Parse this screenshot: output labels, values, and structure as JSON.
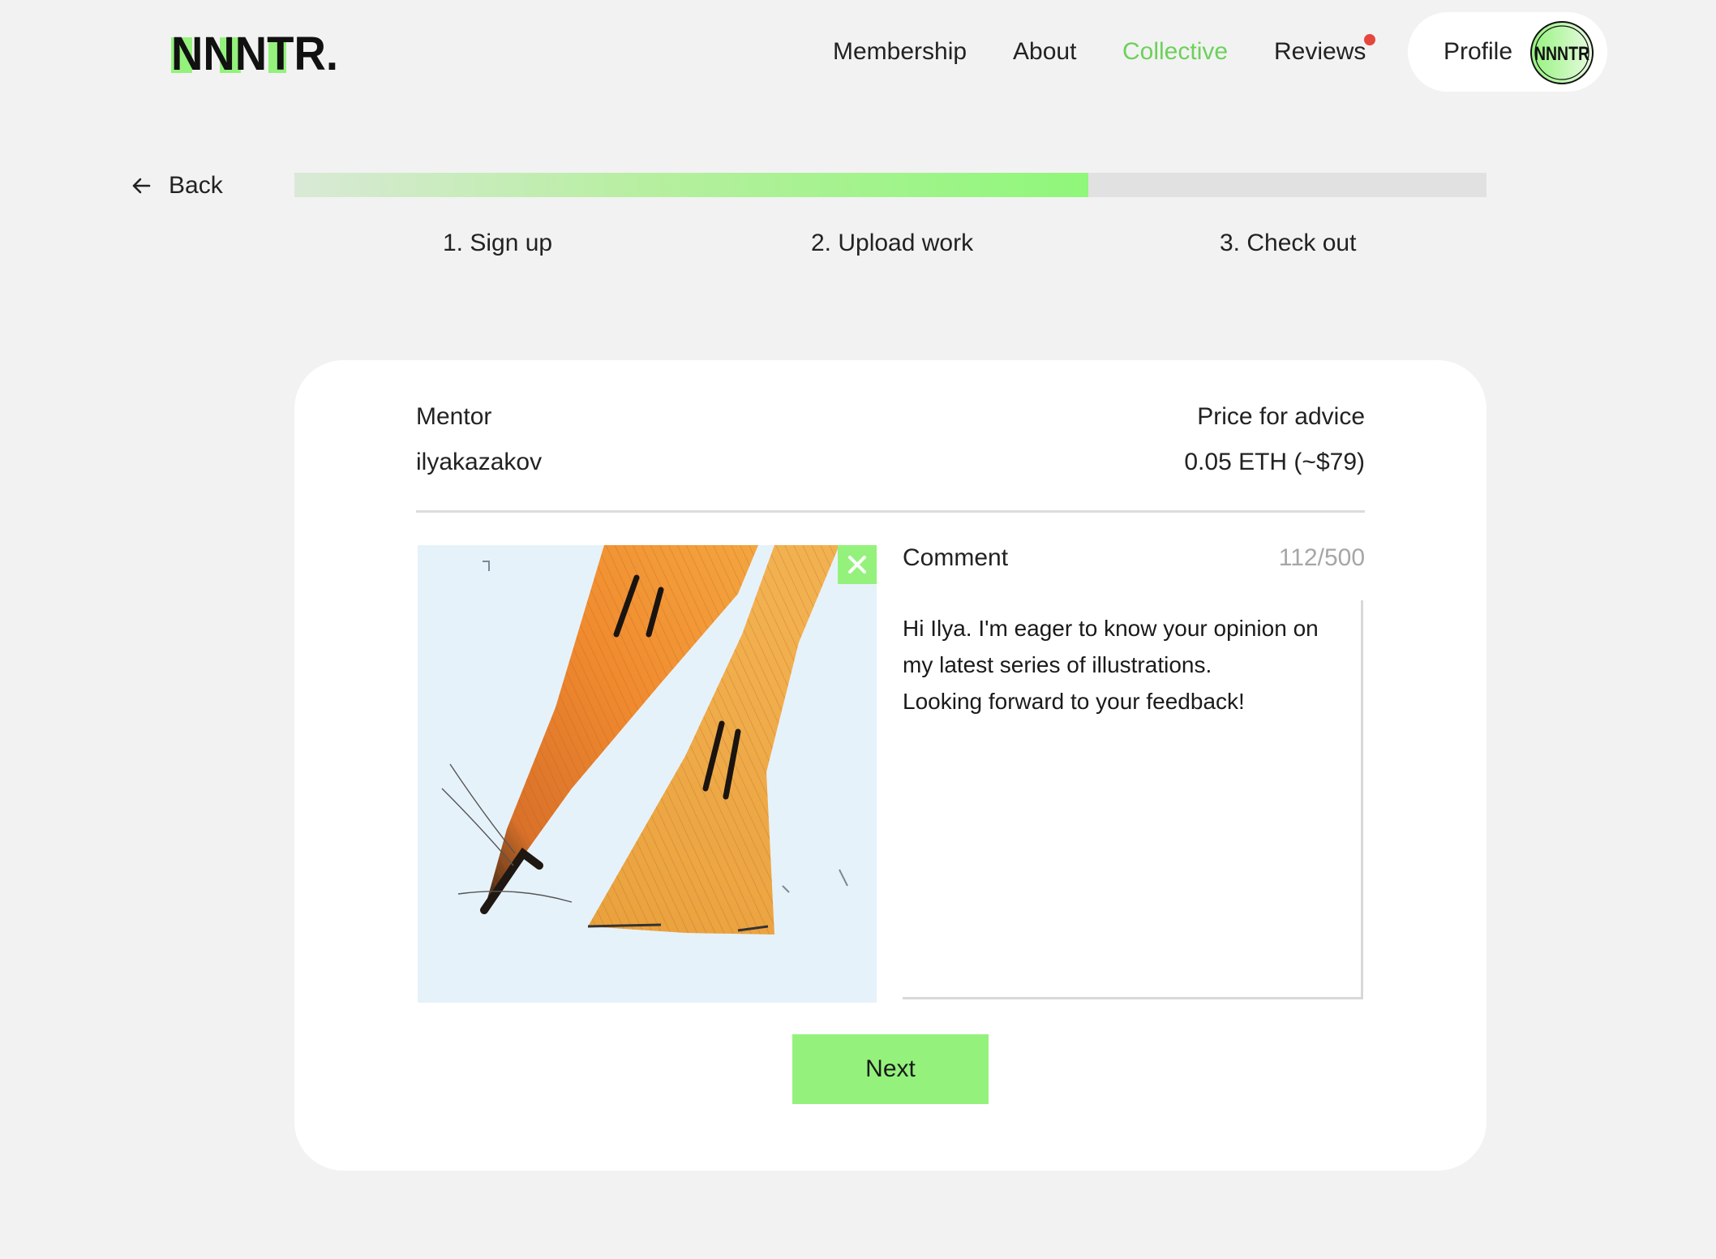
{
  "header": {
    "logo_text": "NNNTR.",
    "nav": [
      {
        "label": "Membership"
      },
      {
        "label": "About"
      },
      {
        "label": "Collective",
        "active": true
      },
      {
        "label": "Reviews",
        "has_notification": true
      }
    ],
    "profile_label": "Profile",
    "avatar_text": "NNNTR"
  },
  "progress": {
    "back_label": "Back",
    "percent": 66.6,
    "steps": [
      "1. Sign up",
      "2. Upload work",
      "3. Check out"
    ]
  },
  "card": {
    "mentor_label": "Mentor",
    "mentor_value": "ilyakazakov",
    "price_label": "Price for advice",
    "price_value": "0.05 ETH (~$79)",
    "comment_label": "Comment",
    "comment_counter": "112/500",
    "comment_text": "Hi Ilya. I'm eager to know your opinion on my latest series of illustrations.\nLooking forward to your feedback!",
    "next_label": "Next"
  },
  "colors": {
    "accent": "#94f27c",
    "active_nav": "#6cd15a",
    "notification": "#e6473d",
    "background": "#f2f2f2"
  }
}
